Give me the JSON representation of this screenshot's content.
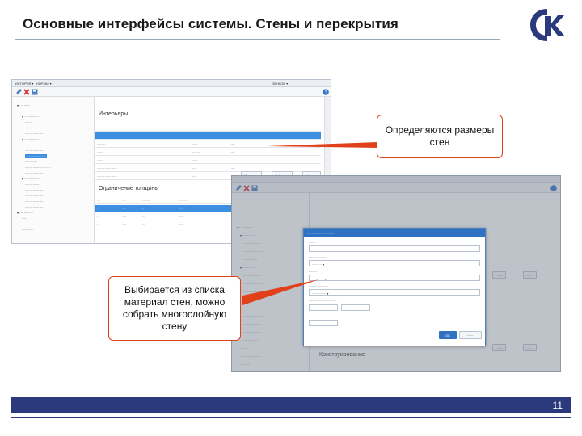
{
  "slide": {
    "title": "Основные интерфейсы системы. Стены и перекрытия",
    "page_number": "11",
    "accent_color": "#2a3a7d",
    "callout_color": "#e0401a"
  },
  "callouts": {
    "top": "Определяются размеры стен",
    "bottom": "Выбирается из списка материал стен, можно собрать многослойную стену"
  },
  "shot1": {
    "panel_title": "Интерьеры",
    "lower_title": "Ограничение толщины",
    "buttons": [
      "Изменить",
      "Добавить",
      "Удалить"
    ]
  },
  "shot2": {
    "bottom_heading": "Конструирование",
    "ok_label": "OK"
  }
}
